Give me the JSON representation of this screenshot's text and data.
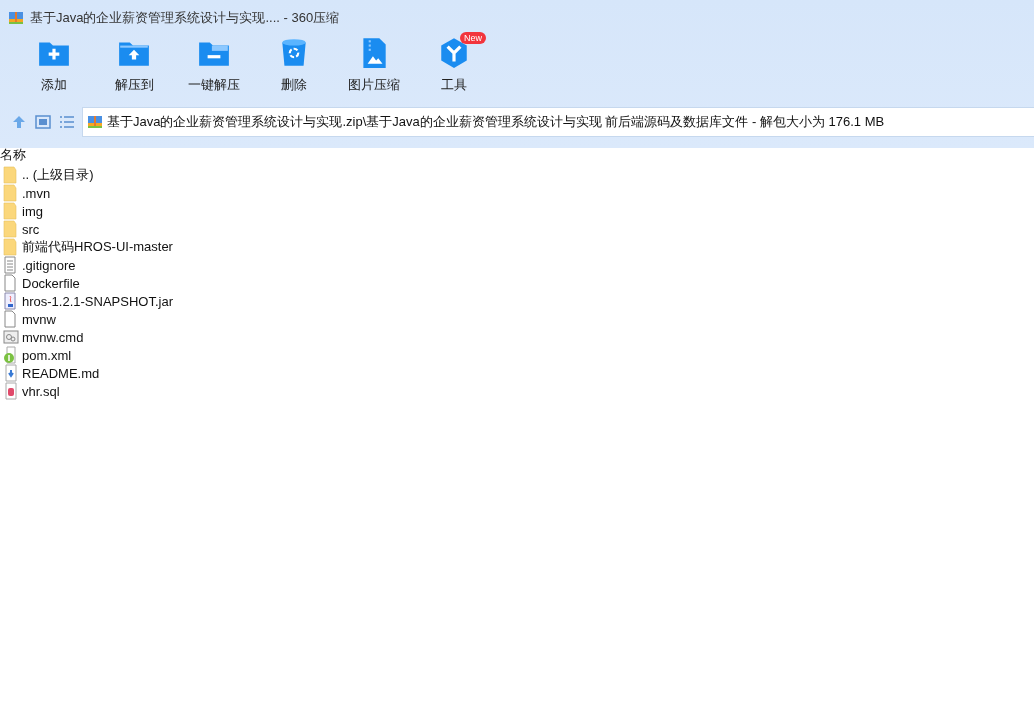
{
  "window": {
    "title": "基于Java的企业薪资管理系统设计与实现.... - 360压缩"
  },
  "toolbar": [
    {
      "kind": "add",
      "label": "添加"
    },
    {
      "kind": "extract-to",
      "label": "解压到"
    },
    {
      "kind": "extract",
      "label": "一键解压"
    },
    {
      "kind": "delete",
      "label": "删除"
    },
    {
      "kind": "image",
      "label": "图片压缩"
    },
    {
      "kind": "tools",
      "label": "工具",
      "badge": "New"
    }
  ],
  "path": {
    "text": "基于Java的企业薪资管理系统设计与实现.zip\\基于Java的企业薪资管理系统设计与实现 前后端源码及数据库文件 - 解包大小为 176.1 MB"
  },
  "table": {
    "columns": [
      "名称"
    ],
    "rows": [
      {
        "kind": "folder",
        "name": ".. (上级目录)"
      },
      {
        "kind": "folder",
        "name": ".mvn"
      },
      {
        "kind": "folder",
        "name": "img"
      },
      {
        "kind": "folder",
        "name": "src"
      },
      {
        "kind": "folder",
        "name": "前端代码HROS-UI-master"
      },
      {
        "kind": "text",
        "name": ".gitignore"
      },
      {
        "kind": "blank",
        "name": "Dockerfile"
      },
      {
        "kind": "jar",
        "name": "hros-1.2.1-SNAPSHOT.jar"
      },
      {
        "kind": "blank",
        "name": "mvnw"
      },
      {
        "kind": "cmd",
        "name": "mvnw.cmd"
      },
      {
        "kind": "xml",
        "name": "pom.xml"
      },
      {
        "kind": "md",
        "name": "README.md"
      },
      {
        "kind": "sql",
        "name": "vhr.sql"
      }
    ]
  }
}
